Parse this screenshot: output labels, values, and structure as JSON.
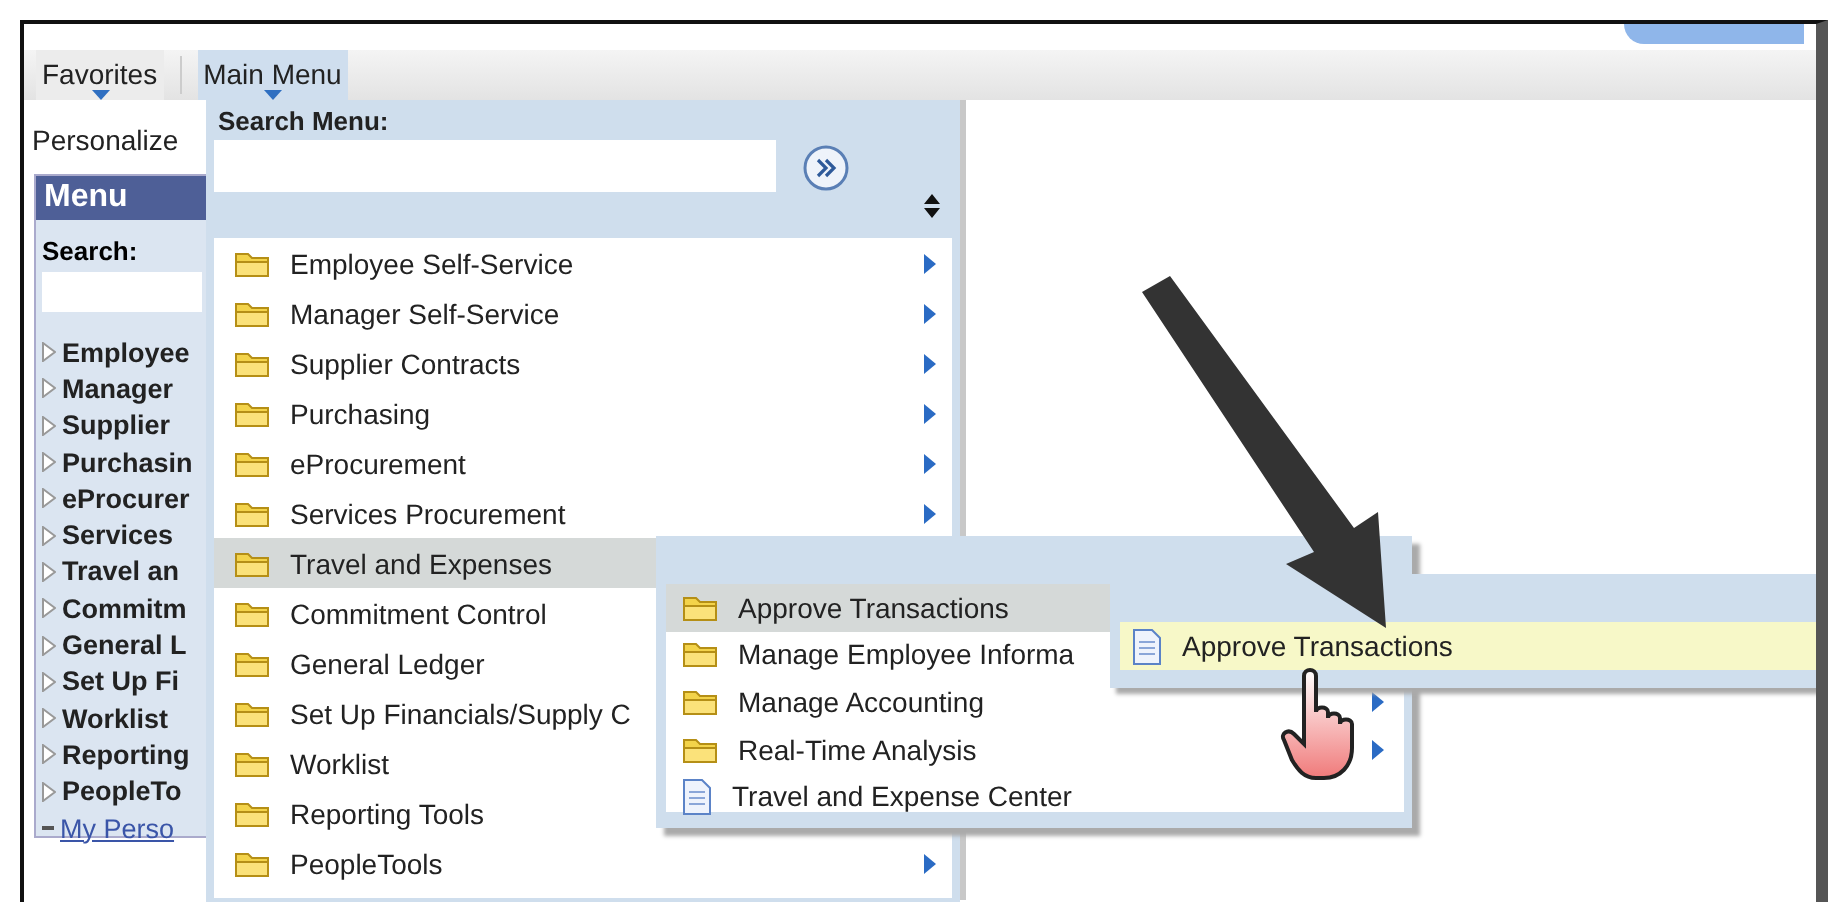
{
  "nav": {
    "items": [
      {
        "label": "Favorites",
        "selected": false
      },
      {
        "label": "Main Menu",
        "selected": true
      }
    ]
  },
  "sidebar": {
    "personalize": "Personalize",
    "title": "Menu",
    "search_label": "Search:",
    "items": [
      {
        "label": "Employee"
      },
      {
        "label": "Manager"
      },
      {
        "label": "Supplier"
      },
      {
        "label": "Purchasin"
      },
      {
        "label": "eProcurer"
      },
      {
        "label": "Services"
      },
      {
        "label": "Travel an"
      },
      {
        "label": "Commitm"
      },
      {
        "label": "General L"
      },
      {
        "label": "Set Up Fi"
      },
      {
        "label": "Worklist"
      },
      {
        "label": "Reporting"
      },
      {
        "label": "PeopleTo"
      }
    ],
    "link": "My Perso"
  },
  "main_menu": {
    "search_label": "Search Menu:",
    "items": [
      {
        "label": "Employee Self-Service",
        "kind": "folder",
        "arrow": true,
        "selected": false
      },
      {
        "label": "Manager Self-Service",
        "kind": "folder",
        "arrow": true,
        "selected": false
      },
      {
        "label": "Supplier Contracts",
        "kind": "folder",
        "arrow": true,
        "selected": false
      },
      {
        "label": "Purchasing",
        "kind": "folder",
        "arrow": true,
        "selected": false
      },
      {
        "label": "eProcurement",
        "kind": "folder",
        "arrow": true,
        "selected": false
      },
      {
        "label": "Services Procurement",
        "kind": "folder",
        "arrow": true,
        "selected": false
      },
      {
        "label": "Travel and Expenses",
        "kind": "folder",
        "selected": true
      },
      {
        "label": "Commitment Control",
        "kind": "folder",
        "selected": false
      },
      {
        "label": "General Ledger",
        "kind": "folder",
        "selected": false
      },
      {
        "label": "Set Up Financials/Supply C",
        "kind": "folder",
        "selected": false
      },
      {
        "label": "Worklist",
        "kind": "folder",
        "selected": false
      },
      {
        "label": "Reporting Tools",
        "kind": "folder",
        "selected": false
      },
      {
        "label": "PeopleTools",
        "kind": "folder",
        "arrow": true,
        "selected": false
      }
    ]
  },
  "submenu": {
    "items": [
      {
        "label": "Approve Transactions",
        "kind": "folder",
        "selected": true
      },
      {
        "label": "Manage Employee Informa",
        "kind": "folder",
        "selected": false
      },
      {
        "label": "Manage Accounting",
        "kind": "folder",
        "arrow": true,
        "selected": false
      },
      {
        "label": "Real-Time Analysis",
        "kind": "folder",
        "arrow": true,
        "selected": false
      },
      {
        "label": "Travel and Expense Center",
        "kind": "page",
        "selected": false
      }
    ]
  },
  "submenu_2": {
    "items": [
      {
        "label": "Approve Transactions",
        "kind": "page",
        "selected": true
      }
    ]
  }
}
